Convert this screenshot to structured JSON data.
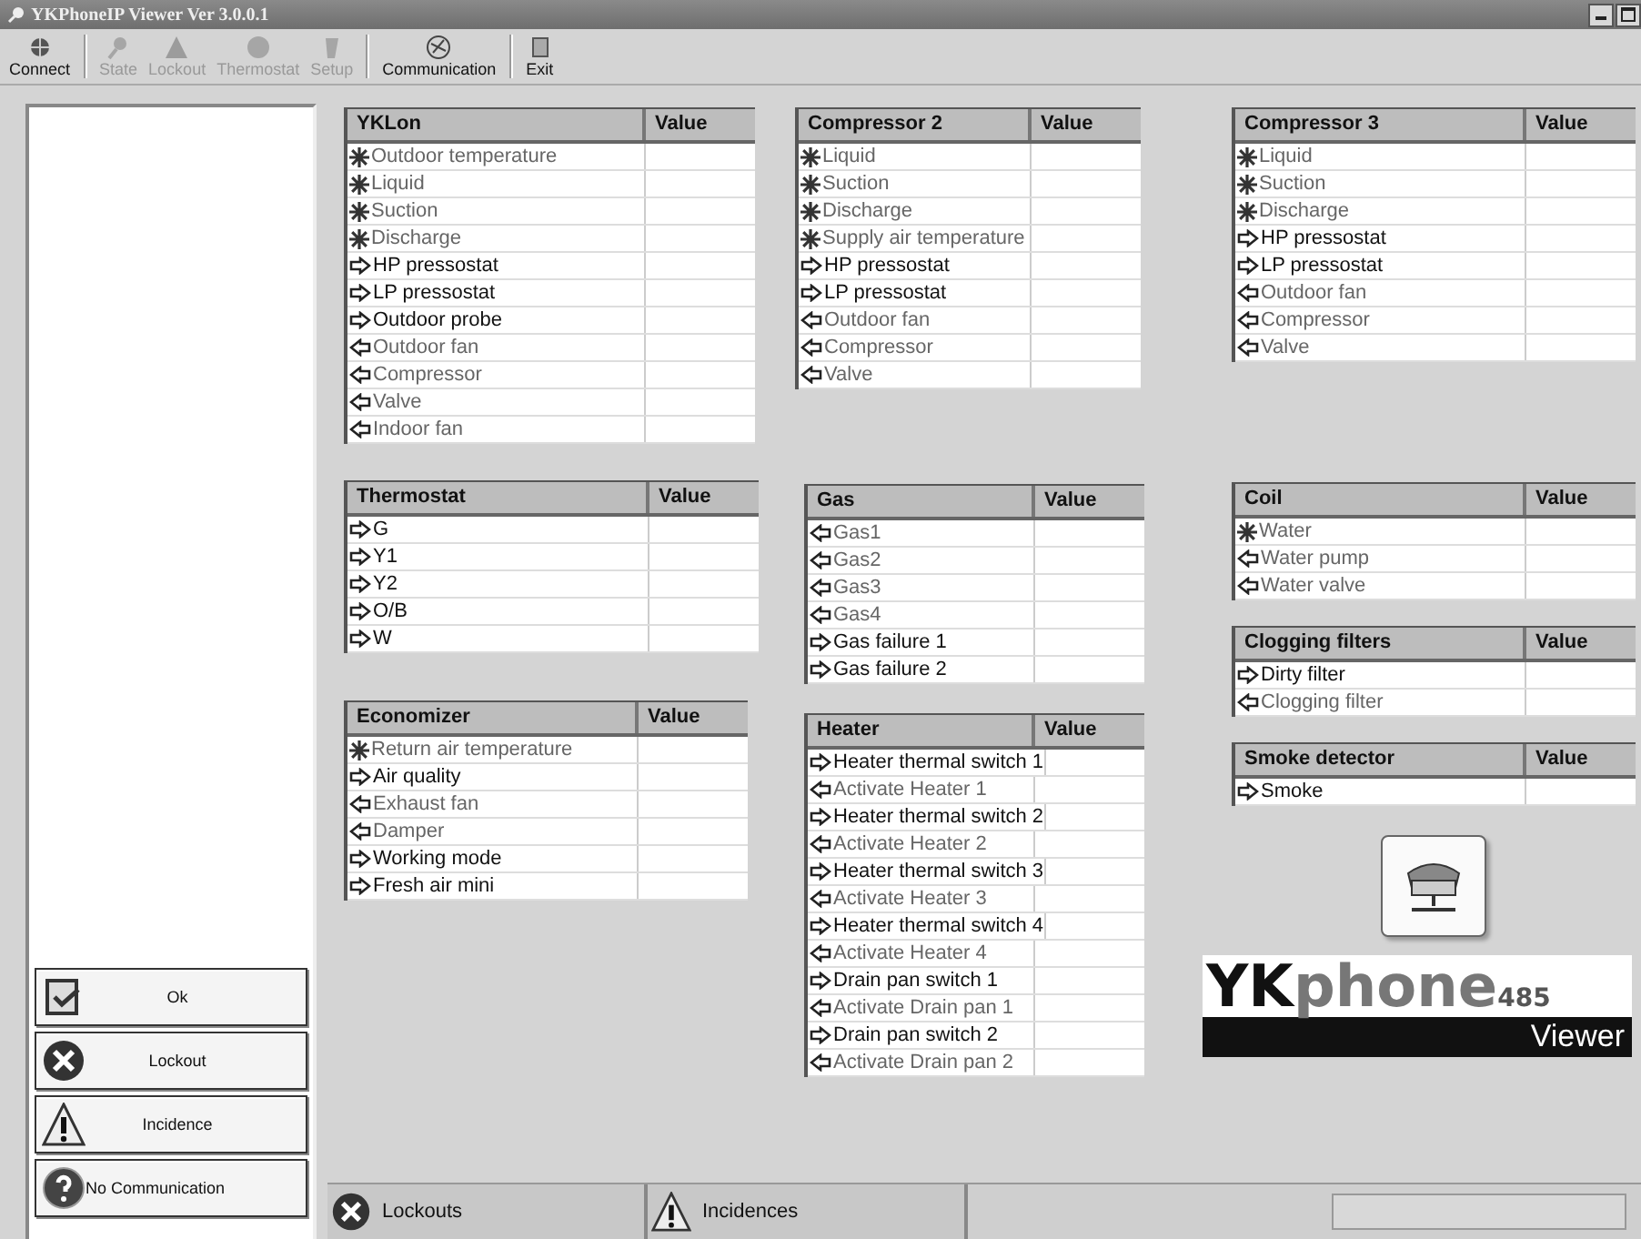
{
  "window": {
    "title": "YKPhoneIP Viewer Ver 3.0.0.1"
  },
  "toolbar": [
    {
      "label": "Connect",
      "disabled": false
    },
    {
      "label": "State",
      "disabled": true
    },
    {
      "label": "Lockout",
      "disabled": true
    },
    {
      "label": "Thermostat",
      "disabled": true
    },
    {
      "label": "Setup",
      "disabled": true
    },
    {
      "label": "Communication",
      "disabled": false
    },
    {
      "label": "Exit",
      "disabled": false
    }
  ],
  "legend": [
    {
      "label": "Ok",
      "kind": "ok"
    },
    {
      "label": "Lockout",
      "kind": "lockout"
    },
    {
      "label": "Incidence",
      "kind": "incidence"
    },
    {
      "label": "No Communication",
      "kind": "nocomm"
    }
  ],
  "columns": [
    [
      {
        "title": "YKLon",
        "value_header": "Value",
        "rows": [
          {
            "label": "Outdoor temperature",
            "kind": "sensor"
          },
          {
            "label": "Liquid",
            "kind": "sensor"
          },
          {
            "label": "Suction",
            "kind": "sensor"
          },
          {
            "label": "Discharge",
            "kind": "sensor"
          },
          {
            "label": "HP pressostat",
            "kind": "input"
          },
          {
            "label": "LP pressostat",
            "kind": "input"
          },
          {
            "label": "Outdoor probe",
            "kind": "input"
          },
          {
            "label": "Outdoor fan",
            "kind": "output"
          },
          {
            "label": "Compressor",
            "kind": "output"
          },
          {
            "label": "Valve",
            "kind": "output"
          },
          {
            "label": "Indoor fan",
            "kind": "output"
          }
        ]
      },
      {
        "title": "Thermostat",
        "value_header": "Value",
        "rows": [
          {
            "label": "G",
            "kind": "input"
          },
          {
            "label": "Y1",
            "kind": "input"
          },
          {
            "label": "Y2",
            "kind": "input"
          },
          {
            "label": "O/B",
            "kind": "input"
          },
          {
            "label": "W",
            "kind": "input"
          }
        ]
      },
      {
        "title": "Economizer",
        "value_header": "Value",
        "rows": [
          {
            "label": "Return air temperature",
            "kind": "sensor"
          },
          {
            "label": "Air quality",
            "kind": "input"
          },
          {
            "label": "Exhaust fan",
            "kind": "output"
          },
          {
            "label": "Damper",
            "kind": "output"
          },
          {
            "label": "Working mode",
            "kind": "input"
          },
          {
            "label": "Fresh air mini",
            "kind": "input"
          }
        ]
      }
    ],
    [
      {
        "title": "Compressor 2",
        "value_header": "Value",
        "rows": [
          {
            "label": "Liquid",
            "kind": "sensor"
          },
          {
            "label": "Suction",
            "kind": "sensor"
          },
          {
            "label": "Discharge",
            "kind": "sensor"
          },
          {
            "label": "Supply air temperature",
            "kind": "sensor"
          },
          {
            "label": "HP pressostat",
            "kind": "input"
          },
          {
            "label": "LP pressostat",
            "kind": "input"
          },
          {
            "label": "Outdoor fan",
            "kind": "output"
          },
          {
            "label": "Compressor",
            "kind": "output"
          },
          {
            "label": "Valve",
            "kind": "output"
          }
        ]
      },
      {
        "title": "Gas",
        "value_header": "Value",
        "rows": [
          {
            "label": "Gas1",
            "kind": "output"
          },
          {
            "label": "Gas2",
            "kind": "output"
          },
          {
            "label": "Gas3",
            "kind": "output"
          },
          {
            "label": "Gas4",
            "kind": "output"
          },
          {
            "label": "Gas failure 1",
            "kind": "input"
          },
          {
            "label": "Gas failure 2",
            "kind": "input"
          }
        ]
      },
      {
        "title": "Heater",
        "value_header": "Value",
        "rows": [
          {
            "label": "Heater thermal switch 1",
            "kind": "input"
          },
          {
            "label": "Activate Heater 1",
            "kind": "output"
          },
          {
            "label": "Heater thermal switch 2",
            "kind": "input"
          },
          {
            "label": "Activate Heater 2",
            "kind": "output"
          },
          {
            "label": "Heater thermal switch 3",
            "kind": "input"
          },
          {
            "label": "Activate Heater 3",
            "kind": "output"
          },
          {
            "label": "Heater thermal switch 4",
            "kind": "input"
          },
          {
            "label": "Activate Heater 4",
            "kind": "output"
          },
          {
            "label": "Drain pan switch 1",
            "kind": "input"
          },
          {
            "label": "Activate Drain pan 1",
            "kind": "output"
          },
          {
            "label": "Drain pan switch 2",
            "kind": "input"
          },
          {
            "label": "Activate Drain pan 2",
            "kind": "output"
          }
        ]
      }
    ],
    [
      {
        "title": "Compressor 3",
        "value_header": "Value",
        "rows": [
          {
            "label": "Liquid",
            "kind": "sensor"
          },
          {
            "label": "Suction",
            "kind": "sensor"
          },
          {
            "label": "Discharge",
            "kind": "sensor"
          },
          {
            "label": "HP pressostat",
            "kind": "input"
          },
          {
            "label": "LP pressostat",
            "kind": "input"
          },
          {
            "label": "Outdoor fan",
            "kind": "output"
          },
          {
            "label": "Compressor",
            "kind": "output"
          },
          {
            "label": "Valve",
            "kind": "output"
          }
        ]
      },
      {
        "title": "Coil",
        "value_header": "Value",
        "rows": [
          {
            "label": "Water",
            "kind": "sensor"
          },
          {
            "label": "Water pump",
            "kind": "output"
          },
          {
            "label": "Water valve",
            "kind": "output"
          }
        ]
      },
      {
        "title": "Clogging filters",
        "value_header": "Value",
        "rows": [
          {
            "label": "Dirty filter",
            "kind": "input"
          },
          {
            "label": "Clogging filter",
            "kind": "output"
          }
        ]
      },
      {
        "title": "Smoke detector",
        "value_header": "Value",
        "rows": [
          {
            "label": "Smoke",
            "kind": "input"
          }
        ]
      }
    ]
  ],
  "logo": {
    "prefix": "YK",
    "name": "phone",
    "suffix": "485",
    "subtitle": "Viewer"
  },
  "status_bar": [
    {
      "label": "Lockouts",
      "kind": "lockout"
    },
    {
      "label": "Incidences",
      "kind": "incidence"
    }
  ]
}
